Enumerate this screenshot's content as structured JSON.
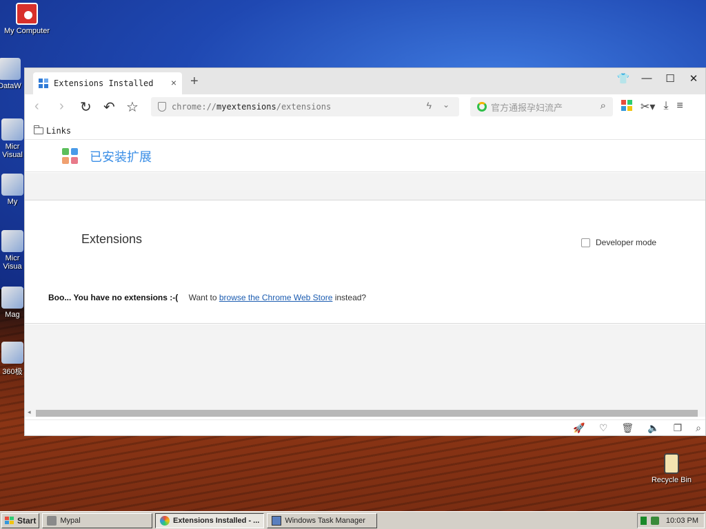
{
  "desktop": {
    "icons": [
      {
        "label": "My Computer"
      },
      {
        "label": "DataW"
      },
      {
        "label": "Micr Visual"
      },
      {
        "label": "My"
      },
      {
        "label": "Micr Visua"
      },
      {
        "label": "Mag"
      },
      {
        "label": "360极"
      },
      {
        "label": "Recycle Bin"
      }
    ]
  },
  "browser": {
    "tab": {
      "title": "Extensions Installed",
      "close": "×"
    },
    "new_tab": "+",
    "window_controls": {
      "skin": "👕",
      "minimize": "—",
      "maximize": "☐",
      "close": "✕"
    },
    "nav": {
      "back": "‹",
      "forward": "›",
      "reload": "↻",
      "undo": "↶",
      "favorite": "☆"
    },
    "address": {
      "prefix": "chrome://",
      "host": "myextensions",
      "path": "/extensions"
    },
    "search": {
      "placeholder": "官方通报孕妇流产"
    },
    "bookmarks": {
      "folder_label": "Links"
    },
    "page_header": {
      "title": "已安装扩展"
    },
    "content": {
      "heading": "Extensions",
      "developer_mode": "Developer mode",
      "empty_bold": "Boo... You have no extensions :-(",
      "empty_pre": "Want to ",
      "empty_link": "browse the Chrome Web Store",
      "empty_post": " instead?"
    }
  },
  "taskbar": {
    "start": "Start",
    "tasks": [
      {
        "label": "Mypal"
      },
      {
        "label": "Extensions Installed - ..."
      },
      {
        "label": "Windows Task Manager"
      }
    ],
    "clock": "10:03 PM"
  },
  "colors": {
    "accent": "#3a8ee6",
    "link": "#1a5bb0"
  }
}
